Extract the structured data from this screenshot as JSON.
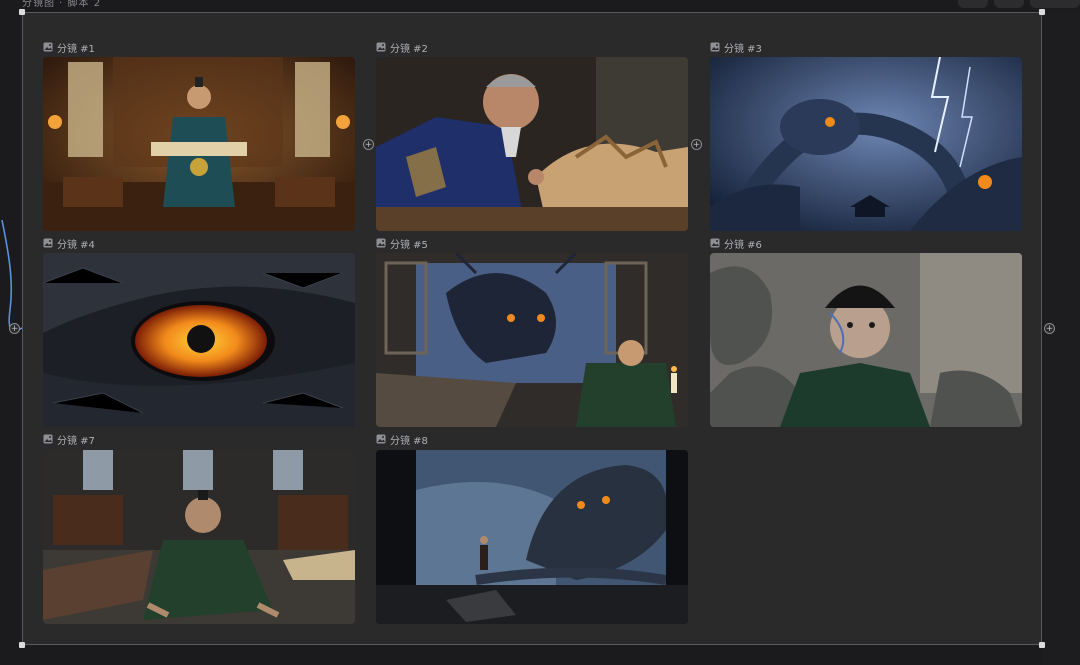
{
  "header": {
    "title": "分镜图 · 脚本 2"
  },
  "storyboard": {
    "add_symbol": "+",
    "shots": [
      {
        "label": "分镜 #1",
        "scene": "official-holding-scroll"
      },
      {
        "label": "分镜 #2",
        "scene": "carver-dragon-sculpture"
      },
      {
        "label": "分镜 #3",
        "scene": "dragons-in-storm"
      },
      {
        "label": "分镜 #4",
        "scene": "dragon-eye-closeup"
      },
      {
        "label": "分镜 #5",
        "scene": "dragon-at-window-official"
      },
      {
        "label": "分镜 #6",
        "scene": "terrified-man-dragon-carvings"
      },
      {
        "label": "分镜 #7",
        "scene": "official-crawling-floor"
      },
      {
        "label": "分镜 #8",
        "scene": "dragon-outside-window"
      }
    ]
  },
  "colors": {
    "canvas_bg": "#2a2a2b",
    "page_bg": "#1b1b1d",
    "label_text": "#aeb0b4",
    "dragon_eye": "#f28a1b",
    "storm_blue": "#4a6a9a"
  }
}
